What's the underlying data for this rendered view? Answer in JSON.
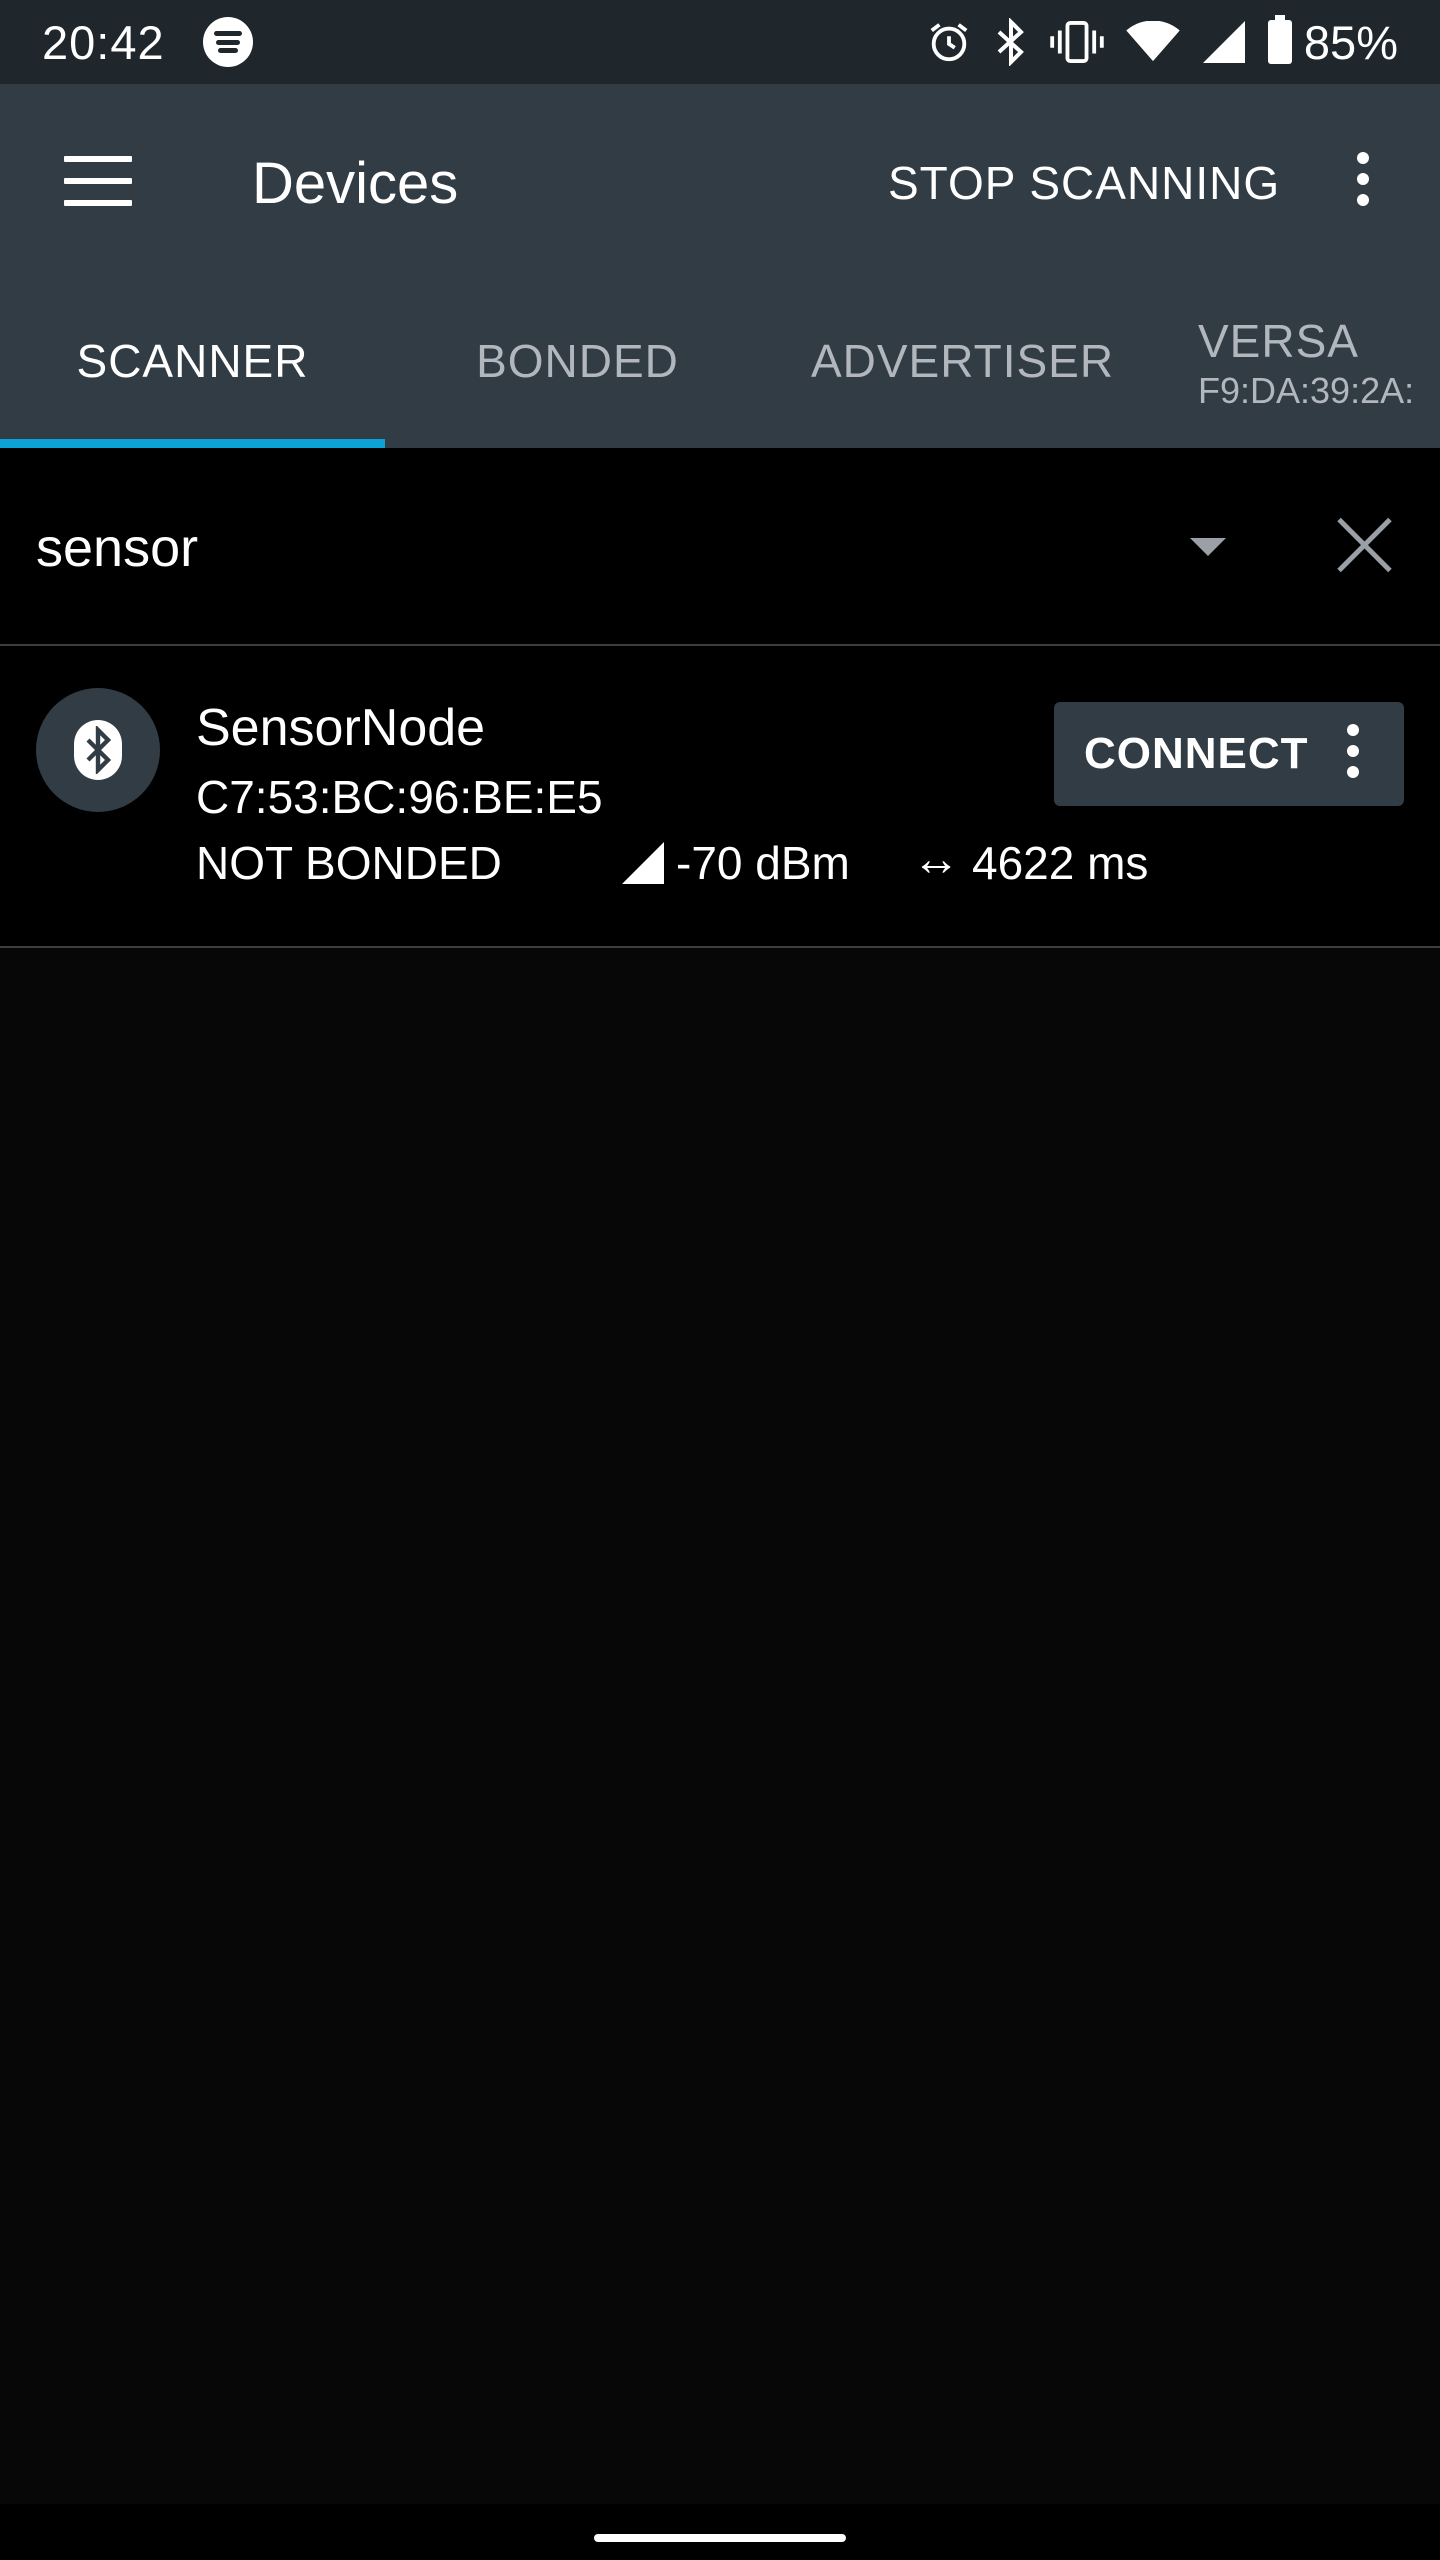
{
  "status_bar": {
    "time": "20:42",
    "battery": "85%",
    "icons": [
      "spotify-icon",
      "alarm-icon",
      "bluetooth-icon",
      "vibrate-icon",
      "wifi-icon",
      "cell-signal-icon",
      "battery-icon"
    ]
  },
  "app_bar": {
    "title": "Devices",
    "action": "STOP SCANNING",
    "icons": [
      "menu-icon",
      "overflow-icon"
    ]
  },
  "tabs": [
    {
      "label": "SCANNER",
      "active": true
    },
    {
      "label": "BONDED",
      "active": false
    },
    {
      "label": "ADVERTISER",
      "active": false
    },
    {
      "label": "VERSA",
      "sublabel": "F9:DA:39:2A:",
      "active": false
    }
  ],
  "colors": {
    "status_bar": "#20272c",
    "app_bar": "#323c45",
    "accent": "#0da2d6",
    "background": "#070707"
  },
  "filter": {
    "value": "sensor"
  },
  "devices": [
    {
      "name": "SensorNode",
      "address": "C7:53:BC:96:BE:E5",
      "bond_state": "NOT BONDED",
      "rssi": "-70 dBm",
      "interval": "4622 ms",
      "connect_label": "CONNECT"
    }
  ]
}
